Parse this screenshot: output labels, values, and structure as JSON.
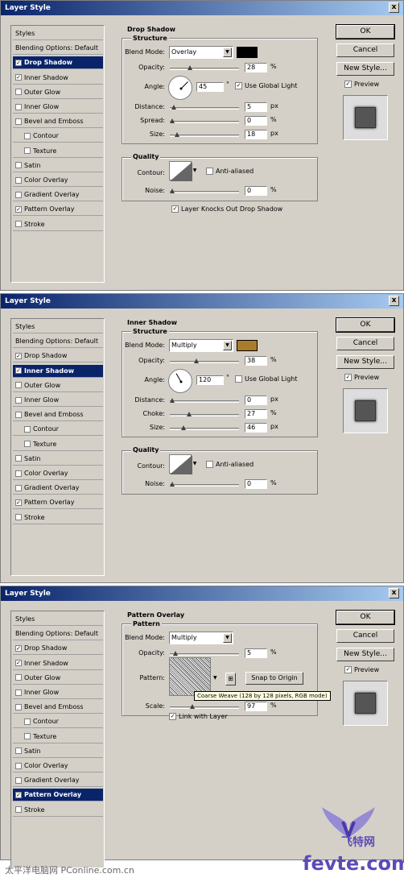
{
  "dialog_title": "Layer Style",
  "close_glyph": "x",
  "styles_list": [
    {
      "label": "Styles",
      "checkbox": false,
      "sub": false
    },
    {
      "label": "Blending Options: Default",
      "checkbox": false,
      "sub": false
    },
    {
      "label": "Drop Shadow",
      "checkbox": true,
      "sub": false
    },
    {
      "label": "Inner Shadow",
      "checkbox": true,
      "sub": false
    },
    {
      "label": "Outer Glow",
      "checkbox": true,
      "sub": false
    },
    {
      "label": "Inner Glow",
      "checkbox": true,
      "sub": false
    },
    {
      "label": "Bevel and Emboss",
      "checkbox": true,
      "sub": false
    },
    {
      "label": "Contour",
      "checkbox": true,
      "sub": true
    },
    {
      "label": "Texture",
      "checkbox": true,
      "sub": true
    },
    {
      "label": "Satin",
      "checkbox": true,
      "sub": false
    },
    {
      "label": "Color Overlay",
      "checkbox": true,
      "sub": false
    },
    {
      "label": "Gradient Overlay",
      "checkbox": true,
      "sub": false
    },
    {
      "label": "Pattern Overlay",
      "checkbox": true,
      "sub": false
    },
    {
      "label": "Stroke",
      "checkbox": true,
      "sub": false
    }
  ],
  "buttons": {
    "ok": "OK",
    "cancel": "Cancel",
    "new_style": "New Style...",
    "preview": "Preview"
  },
  "check_glyph": "✓",
  "labels": {
    "structure": "Structure",
    "quality": "Quality",
    "pattern": "Pattern",
    "blend_mode": "Blend Mode:",
    "opacity": "Opacity:",
    "angle": "Angle:",
    "distance": "Distance:",
    "spread": "Spread:",
    "size": "Size:",
    "choke": "Choke:",
    "contour": "Contour:",
    "noise": "Noise:",
    "anti_aliased": "Anti-aliased",
    "use_global_light": "Use Global Light",
    "pattern_lbl": "Pattern:",
    "scale": "Scale:",
    "link_with_layer": "Link with Layer",
    "snap_to_origin": "Snap to Origin",
    "layer_knocks_out": "Layer Knocks Out Drop Shadow",
    "pct": "%",
    "px": "px",
    "deg": "°"
  },
  "dialogs": [
    {
      "section": "Drop Shadow",
      "selected_index": 2,
      "checked": [
        2,
        3,
        12
      ],
      "blend_mode": "Overlay",
      "color": "#000000",
      "opacity": "28",
      "opacity_frac": 0.28,
      "angle": "45",
      "angle_deg": 45,
      "use_global_light": true,
      "distance": "5",
      "distance_frac": 0.02,
      "spread": "0",
      "spread_frac": 0.0,
      "size": "18",
      "size_frac": 0.07,
      "noise": "0",
      "anti_aliased": false,
      "layer_knocks_out": true
    },
    {
      "section": "Inner Shadow",
      "selected_index": 3,
      "checked": [
        2,
        3,
        12
      ],
      "blend_mode": "Multiply",
      "color": "#a97c2c",
      "opacity": "38",
      "opacity_frac": 0.38,
      "angle": "120",
      "angle_deg": 120,
      "use_global_light": false,
      "distance": "0",
      "distance_frac": 0.0,
      "choke": "27",
      "choke_frac": 0.27,
      "size": "46",
      "size_frac": 0.18,
      "noise": "0",
      "anti_aliased": false
    },
    {
      "section": "Pattern Overlay",
      "selected_index": 12,
      "checked": [
        2,
        3,
        12
      ],
      "blend_mode": "Multiply",
      "opacity": "5",
      "opacity_frac": 0.05,
      "scale": "97",
      "scale_frac": 0.32,
      "tooltip": "Coarse Weave (128 by 128 pixels, RGB mode)",
      "link_with_layer": true
    }
  ],
  "footer": "太平洋电脑网 PConline.com.cn",
  "watermark": {
    "cn": "飞特网",
    "en": "fevte.com"
  }
}
